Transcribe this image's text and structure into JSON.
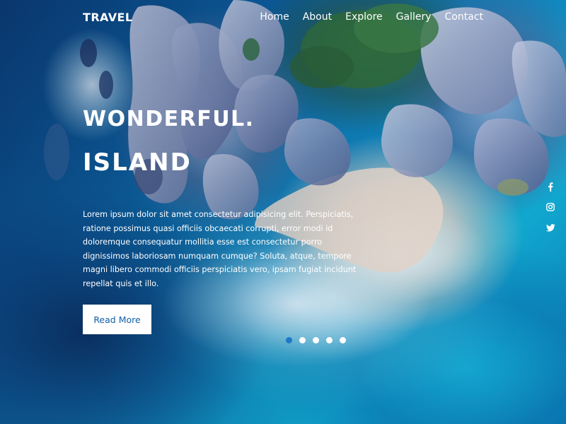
{
  "brand": {
    "name": "TRAVEL"
  },
  "nav": {
    "items": [
      {
        "label": "Home"
      },
      {
        "label": "About"
      },
      {
        "label": "Explore"
      },
      {
        "label": "Gallery"
      },
      {
        "label": "Contact"
      }
    ]
  },
  "hero": {
    "title_line1": "WONDERFUL.",
    "title_line2": "ISLAND",
    "description": "Lorem ipsum dolor sit amet consectetur adipisicing elit. Perspiciatis, ratione possimus quasi officiis obcaecati corrupti, error modi id doloremque consequatur mollitia esse est consectetur porro dignissimos laboriosam numquam cumque? Soluta, atque, tempore magni libero commodi officiis perspiciatis vero, ipsam fugiat incidunt repellat quis et illo.",
    "button_label": "Read More"
  },
  "slider": {
    "dot_count": 5,
    "active_index": 0
  },
  "social": {
    "icons": [
      "facebook-icon",
      "instagram-icon",
      "twitter-icon"
    ]
  },
  "colors": {
    "button_text": "#0f5fa8",
    "active_dot": "#1f77c8",
    "text": "#ffffff"
  }
}
